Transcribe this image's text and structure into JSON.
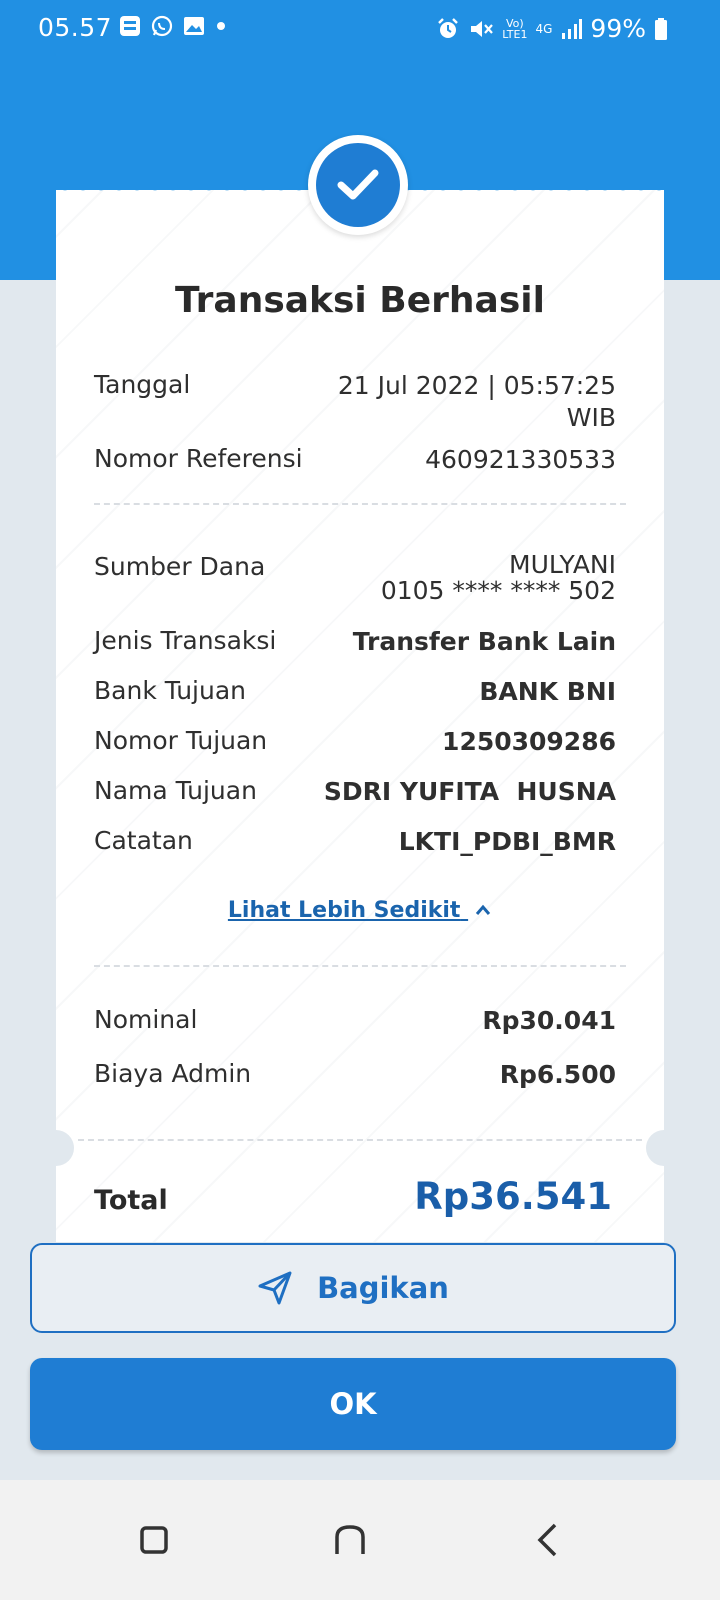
{
  "status_bar": {
    "time": "05.57",
    "battery": "99%",
    "network": "4G",
    "icons": [
      "brimo-icon",
      "whatsapp-icon",
      "gallery-icon",
      "alarm-icon",
      "mute-icon",
      "signal-icon",
      "battery-icon"
    ]
  },
  "receipt": {
    "title": "Transaksi Berhasil",
    "tanggal": {
      "label": "Tanggal",
      "value_line1": "21 Jul 2022 | 05:57:25",
      "value_line2": "WIB"
    },
    "nomor_referensi": {
      "label": "Nomor Referensi",
      "value": "460921330533"
    },
    "sumber_dana": {
      "label": "Sumber Dana",
      "name": "MULYANI",
      "account": "0105 **** **** 502"
    },
    "jenis_transaksi": {
      "label": "Jenis Transaksi",
      "value": "Transfer Bank Lain"
    },
    "bank_tujuan": {
      "label": "Bank Tujuan",
      "value": "BANK BNI"
    },
    "nomor_tujuan": {
      "label": "Nomor Tujuan",
      "value": "1250309286"
    },
    "nama_tujuan": {
      "label": "Nama Tujuan",
      "value": "SDRI YUFITA  HUSNA"
    },
    "catatan": {
      "label": "Catatan",
      "value": "LKTI_PDBI_BMR"
    },
    "toggle_link": "Lihat Lebih Sedikit",
    "nominal": {
      "label": "Nominal",
      "value": "Rp30.041"
    },
    "biaya_admin": {
      "label": "Biaya Admin",
      "value": "Rp6.500"
    },
    "total": {
      "label": "Total",
      "value": "Rp36.541"
    }
  },
  "actions": {
    "share_label": "Bagikan",
    "ok_label": "OK"
  },
  "colors": {
    "primary": "#2190e3",
    "button": "#1f7dd3",
    "total_text": "#1a5ea9",
    "link": "#1a64ad"
  }
}
